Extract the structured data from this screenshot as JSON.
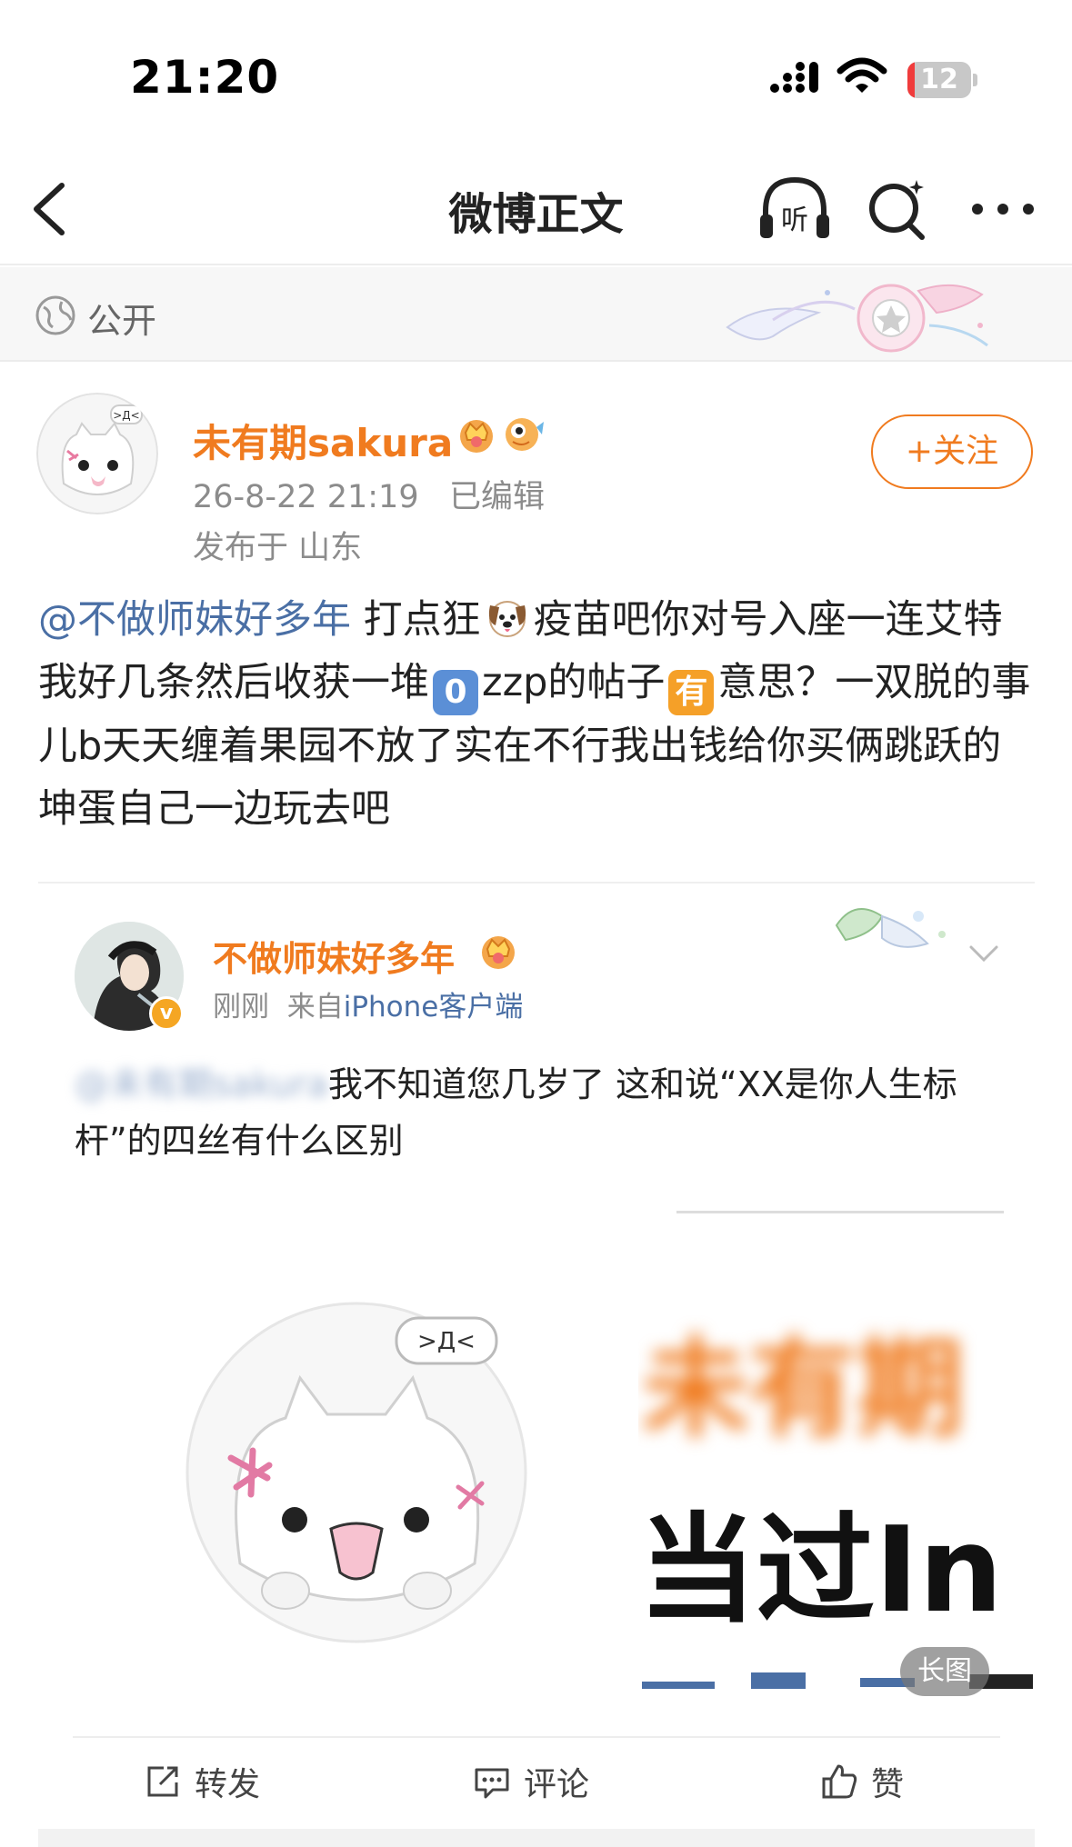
{
  "status_bar": {
    "time": "21:20",
    "battery": "12",
    "battery_level": 0.12,
    "battery_color": "#f03c3c"
  },
  "nav": {
    "title": "微博正文",
    "listen_label": "听"
  },
  "visibility": {
    "label": "公开"
  },
  "post": {
    "author": "未有期sakura",
    "time": "26-8-22 21:19",
    "edited": "已编辑",
    "location": "发布于 山东",
    "follow_label": "+关注",
    "mention": "@不做师妹好多年",
    "text_1": " 打点狂",
    "text_2": "疫苗吧你对号入座一连艾特我好几条然后收获一堆",
    "emoji_zero": "0",
    "text_3": "zzp的帖子",
    "emoji_you": "有",
    "text_4": "意思？一双脱的事儿b天天缠着果园不放了实在不行我出钱给你买俩跳跃的坤蛋自己一边玩去吧"
  },
  "repost": {
    "author": "不做师妹好多年",
    "verified_mark": "v",
    "time": "刚刚",
    "source_prefix": "来自",
    "source": "iPhone客户端",
    "mention_blurred": "@未有期sakura",
    "text": "我不知道您几岁了 这和说“XX是你人生标杆”的四丝有什么区别",
    "image_name_blurred": "未有期",
    "image_text": "当过In",
    "long_image_label": "长图"
  },
  "actions": {
    "repost": "转发",
    "comment": "评论",
    "like": "赞"
  },
  "colors": {
    "accent": "#f07b1f",
    "link": "#4a6fa5"
  }
}
